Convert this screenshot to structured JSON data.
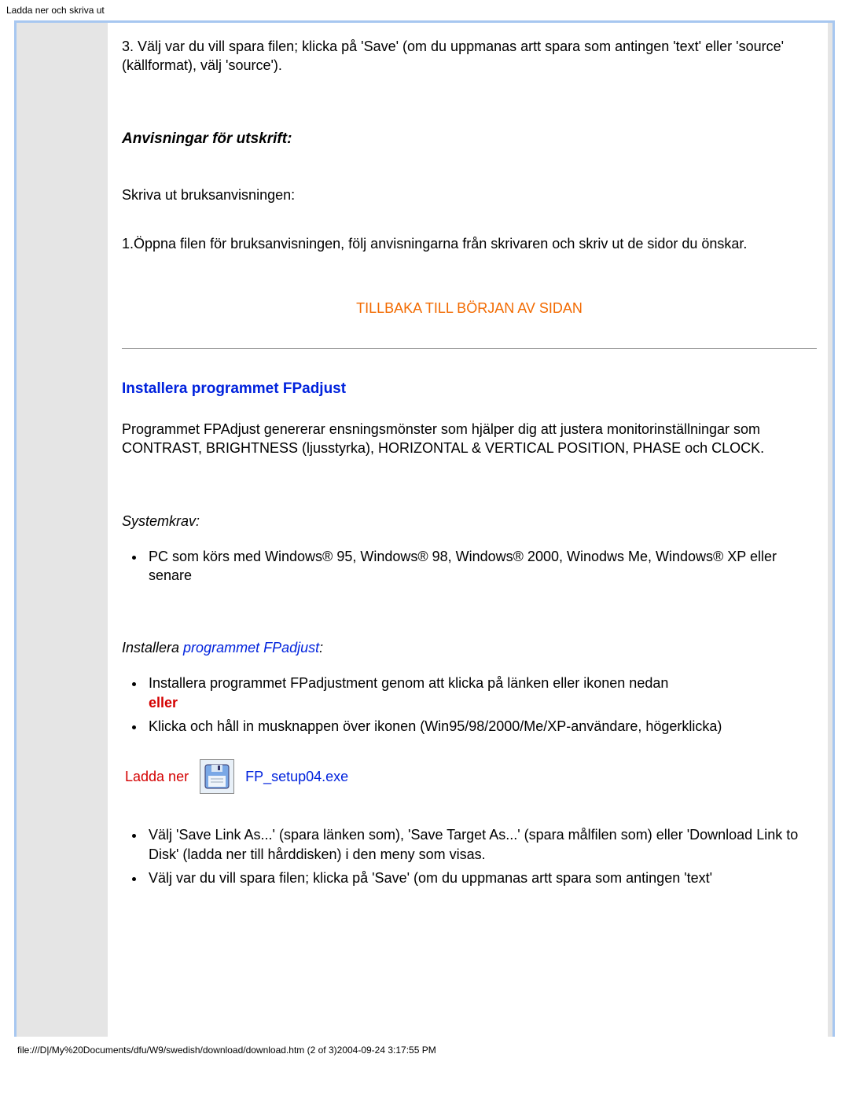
{
  "header": {
    "title": "Ladda ner och skriva ut"
  },
  "intro_step3": "3. Välj var du vill spara filen; klicka på 'Save' (om du uppmanas artt spara som antingen 'text' eller 'source' (källformat), välj 'source').",
  "print": {
    "heading": "Anvisningar för utskrift:",
    "line1": "Skriva ut bruksanvisningen:",
    "line2": "1.Öppna filen för bruksanvisningen, följ anvisningarna från skrivaren och skriv ut de sidor du önskar."
  },
  "top_link": "TILLBAKA TILL BÖRJAN AV SIDAN",
  "fpadjust": {
    "heading": "Installera programmet FPadjust",
    "desc": "Programmet FPAdjust genererar ensningsmönster som hjälper dig att justera monitorinställningar som CONTRAST, BRIGHTNESS (ljusstyrka), HORIZONTAL & VERTICAL POSITION, PHASE och CLOCK.",
    "sysreq_heading": "Systemkrav:",
    "sysreq_item": "PC som körs med Windows® 95, Windows® 98, Windows® 2000, Winodws Me, Windows® XP eller senare",
    "install_prefix": "Installera ",
    "install_link": "programmet FPadjust",
    "install_suffix": ":",
    "bullet_a": "Installera programmet FPadjustment genom att klicka på länken eller ikonen nedan",
    "eller": "eller",
    "bullet_b": "Klicka och håll in musknappen över ikonen (Win95/98/2000/Me/XP-användare, högerklicka)",
    "download_label": "Ladda ner",
    "download_file": "FP_setup04.exe",
    "disk_icon_name": "floppy-disk-icon",
    "post_bullets": [
      "Välj 'Save Link As...' (spara länken som), 'Save Target As...' (spara målfilen som) eller 'Download Link to Disk' (ladda ner till hårddisken) i den meny som visas.",
      "Välj var du vill spara filen; klicka på 'Save' (om du uppmanas artt spara som antingen 'text'"
    ]
  },
  "footer": "file:///D|/My%20Documents/dfu/W9/swedish/download/download.htm (2 of 3)2004-09-24 3:17:55 PM"
}
